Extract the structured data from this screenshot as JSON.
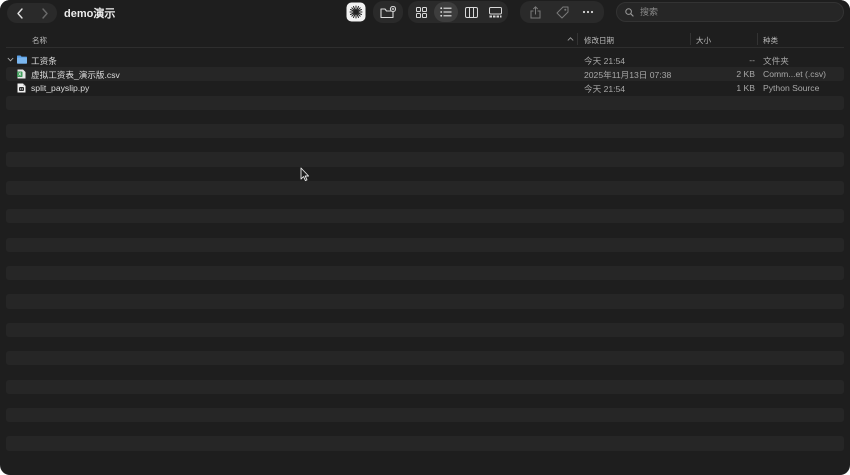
{
  "window": {
    "title": "demo演示"
  },
  "toolbar": {
    "back_icon": "chevron-left-icon",
    "forward_icon": "chevron-right-icon",
    "buttons": [
      {
        "name": "network-app-icon"
      },
      {
        "name": "new-folder-icon"
      },
      {
        "name": "icon-view-icon"
      },
      {
        "name": "list-view-icon"
      },
      {
        "name": "column-view-icon"
      },
      {
        "name": "gallery-view-icon"
      },
      {
        "name": "share-icon"
      },
      {
        "name": "tag-icon"
      },
      {
        "name": "more-icon"
      }
    ],
    "search_placeholder": "搜索"
  },
  "columns": {
    "name": "名称",
    "modified": "修改日期",
    "size": "大小",
    "kind": "种类"
  },
  "files": [
    {
      "name": "工资条",
      "modified": "今天 21:54",
      "size": "--",
      "kind": "文件夹",
      "icon": "folder-icon",
      "expanded": false
    },
    {
      "name": "虚拟工资表_演示版.csv",
      "modified": "2025年11月13日 07:38",
      "size": "2 KB",
      "kind": "Comm...et (.csv)",
      "icon": "csv-file-icon"
    },
    {
      "name": "split_payslip.py",
      "modified": "今天 21:54",
      "size": "1 KB",
      "kind": "Python Source",
      "icon": "python-file-icon"
    }
  ],
  "colors": {
    "window_bg": "#1e1e1e",
    "stripe": "#262626",
    "folder_blue": "#5aa0e6",
    "csv_green": "#3f9a5a",
    "accent_selected": "#3a3a3a"
  }
}
